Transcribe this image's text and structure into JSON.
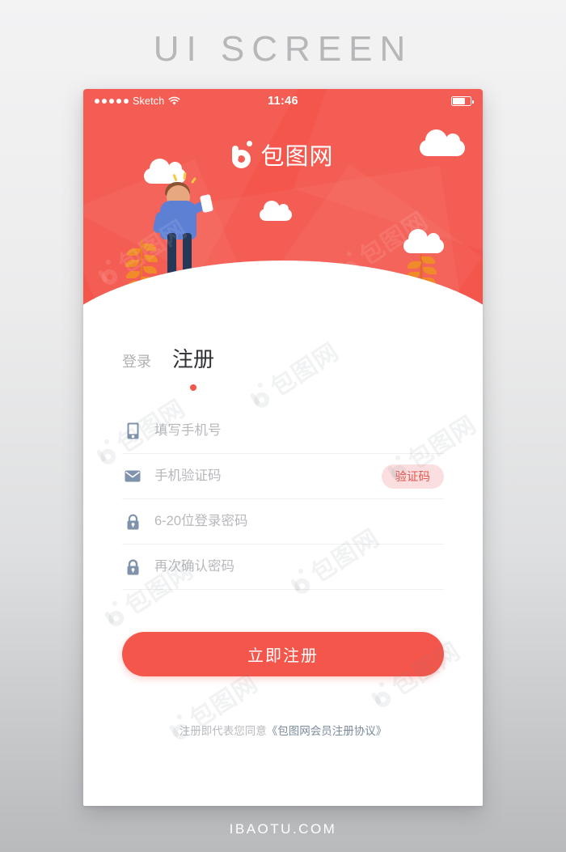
{
  "page": {
    "headline": "UI SCREEN",
    "footer_watermark": "IBAOTU.COM",
    "background_colors": {
      "top": "#f3f3f4",
      "bottom": "#b9babc"
    }
  },
  "watermark": {
    "text": "包图网",
    "repeated": true
  },
  "phone": {
    "status_bar": {
      "signal_dots": 5,
      "carrier": "Sketch",
      "wifi_icon": "wifi-icon",
      "time": "11:46",
      "battery_icon": "battery-icon",
      "battery_level_percent": 72
    },
    "brand": {
      "logo_icon": "baotu-b-logo-icon",
      "name": "包图网"
    },
    "illustration": {
      "person": "person-holding-phone-illustration",
      "clouds": 4,
      "plants": 2,
      "hero_color": "#f4564c"
    },
    "tabs": [
      {
        "id": "login",
        "label": "登录",
        "active": false
      },
      {
        "id": "register",
        "label": "注册",
        "active": true
      }
    ],
    "form": {
      "fields": [
        {
          "id": "phone",
          "icon": "mobile-phone-icon",
          "placeholder": "填写手机号",
          "value": ""
        },
        {
          "id": "sms-code",
          "icon": "envelope-icon",
          "placeholder": "手机验证码",
          "value": "",
          "action_button": "验证码"
        },
        {
          "id": "password",
          "icon": "lock-icon",
          "placeholder": "6-20位登录密码",
          "value": ""
        },
        {
          "id": "confirm-password",
          "icon": "lock-icon",
          "placeholder": "再次确认密码",
          "value": ""
        }
      ],
      "submit_label": "立即注册",
      "submit_color": "#f4564c",
      "code_button_color": "#fbdfe0",
      "code_button_text_color": "#e9564f"
    },
    "agreement": {
      "prefix": "注册即代表您同意",
      "link": "《包图网会员注册协议》"
    }
  }
}
